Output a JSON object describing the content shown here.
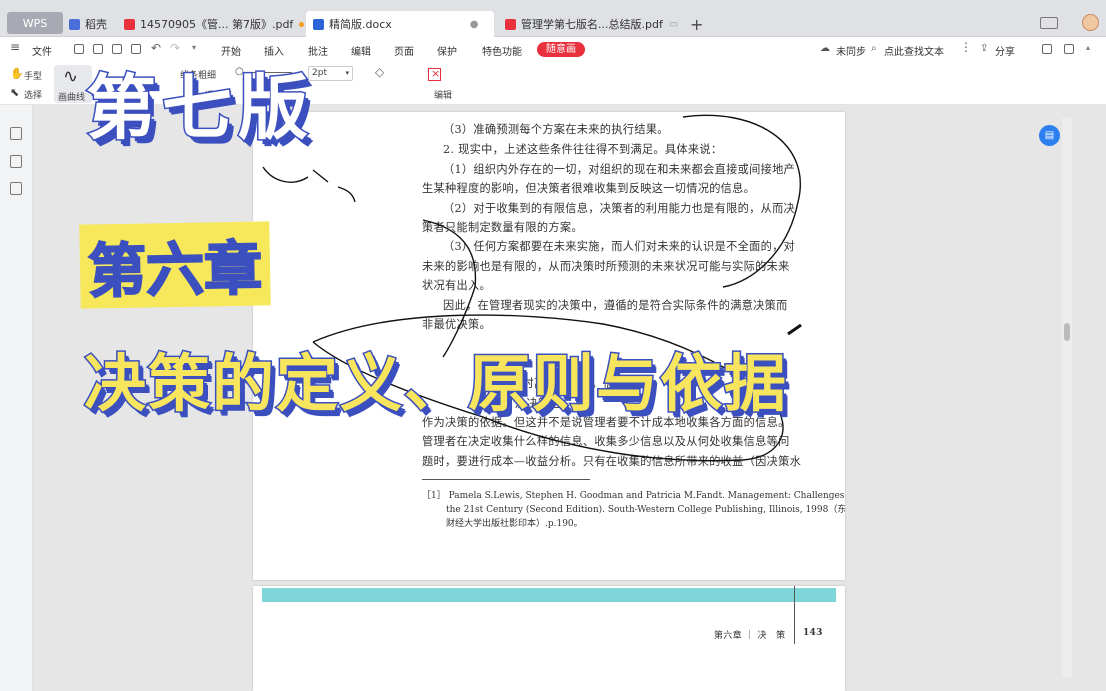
{
  "tabs": {
    "wps": "WPS",
    "daoke": "稻壳",
    "pdf1": "14570905《管... 第7版》.pdf",
    "docx": "精简版.docx",
    "pdf2": "管理学第七版名...总结版.pdf",
    "add": "+"
  },
  "menubar": {
    "file": "文件",
    "items": [
      "开始",
      "插入",
      "批注",
      "编辑",
      "页面",
      "保护",
      "特色功能"
    ],
    "suiyihua": "随意画",
    "sync": "未同步",
    "find": "点此查找文本",
    "share": "分享"
  },
  "toolbar": {
    "hand": "手型",
    "select": "选择",
    "draw": "画曲线",
    "line_width": "线条粗细",
    "transparency": "透明度",
    "size": "2pt",
    "edit": "编辑"
  },
  "overlay": {
    "title1": "第七版",
    "title2": "第六章",
    "title3": "决策的定义、原则与依据"
  },
  "document": {
    "lines": [
      "（3）准确预测每个方案在未来的执行结果。",
      "2. 现实中，上述这些条件往往得不到满足。具体来说：",
      "（1）组织内外存在的一切，对组织的现在和未来都会直接或间接地产",
      "生某种程度的影响，但决策者很难收集到反映这一切情况的信息。",
      "（2）对于收集到的有限信息，决策者的利用能力也是有限的，从而决",
      "策者只能制定数量有限的方案。",
      "（3）任何方案都要在未来实施，而人们对未来的认识是不全面的，对",
      "未来的影响也是有限的，从而决策时所预测的未来状况可能与实际的未来",
      "状况有出入。",
      "因此，在管理者现实的决策中，遵循的是符合实际条件的满意决策而",
      "非最优决策。"
    ],
    "partial_heading": "据",
    "partial_lines": [
      "策时离不开信息。信",
      "及决策这",
      "作为决策的依据。但这并不是说管理者要不计成本地收集各方面的信息。",
      "管理者在决定收集什么样的信息、收集多少信息以及从何处收集信息等问",
      "题时，要进行成本—收益分析。只有在收集的信息所带来的收益（因决策水"
    ],
    "footnote": [
      "［1］ Pamela S.Lewis, Stephen H. Goodman and Patricia M.Fandt. Management: Challenges in",
      "the 21st Century (Second Edition). South-Western College Publishing, Illinois, 1998（东北",
      "财经大学出版社影印本）.p.190。"
    ],
    "page_footer": "第六章 ｜ 决　策",
    "page_number": "143"
  },
  "colors": {
    "accent_red": "#e8313d",
    "title_blue": "#3b4fbf",
    "title_yellow": "#f6e85a",
    "band_teal": "#7fd6d8"
  }
}
